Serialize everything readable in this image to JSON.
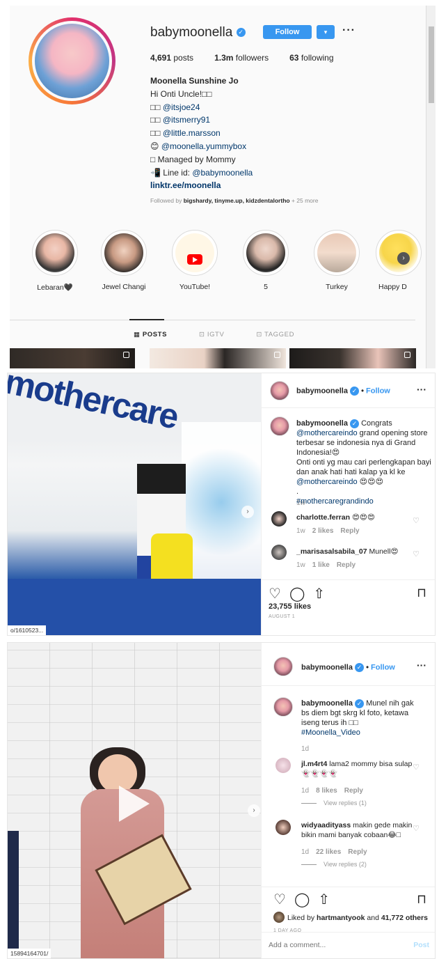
{
  "profile": {
    "username": "babymoonella",
    "follow_label": "Follow",
    "dropdown_label": "▾",
    "more_label": "···",
    "stats": {
      "posts": "4,691",
      "posts_label": "posts",
      "followers": "1.3m",
      "followers_label": "followers",
      "following": "63",
      "following_label": "following"
    },
    "bio": {
      "name": "Moonella Sunshine Jo",
      "line1": "Hi Onti Uncle!□□",
      "line2_prefix": "□□ ",
      "line2_link": "@itsjoe24",
      "line3_prefix": "□□ ",
      "line3_link": "@itsmerry91",
      "line4_prefix": "□□ ",
      "line4_link": "@little.marsson",
      "line5_prefix": "😊 ",
      "line5_link": "@moonella.yummybox",
      "line6": "□ Managed by Mommy",
      "line7_prefix": "📲 Line id: ",
      "line7_link": "@babymoonella",
      "website": "linktr.ee/moonella"
    },
    "followed_by": {
      "prefix": "Followed by ",
      "names": "bigshardy, tinyme.up, kidzdentalortho",
      "suffix": " + 25 more"
    },
    "highlights": [
      {
        "label": "Lebaran🖤"
      },
      {
        "label": "Jewel Changi"
      },
      {
        "label": "YouTube!"
      },
      {
        "label": "5"
      },
      {
        "label": "Turkey"
      },
      {
        "label": "Happy D"
      }
    ],
    "tabs": {
      "posts": "▦ POSTS",
      "igtv": "⊡ IGTV",
      "tagged": "⊡ TAGGED"
    }
  },
  "post1": {
    "header_user": "babymoonella",
    "header_follow": "Follow",
    "caption_user": "babymoonella",
    "caption_text": "Congrats",
    "caption_mention": "@mothercareindo",
    "caption_rest": " grand opening store terbesar se indonesia nya di Grand Indonesia!😍",
    "caption_line2": "Onti onti yg mau cari perlengkapan bayi dan anak hati hati kalap ya kl ke",
    "caption_mention2": "@mothercareindo",
    "caption_emoji": " 😍😍😍",
    "caption_dot": ".",
    "caption_hashtag": "#mothercaregrandindo",
    "caption_age": "1w",
    "comments": [
      {
        "user": "charlotte.ferran",
        "text": " 😍😍😍",
        "age": "1w",
        "likes": "2 likes",
        "reply": "Reply"
      },
      {
        "user": "_marisasalsabila_07",
        "text": " Munell😍",
        "age": "1w",
        "likes": "1 like",
        "reply": "Reply"
      }
    ],
    "likes": "23,755 likes",
    "date": "AUGUST 1",
    "photo_sign": "mothercare",
    "url_fragment": "o/1610523..."
  },
  "post2": {
    "header_user": "babymoonella",
    "header_follow": "Follow",
    "caption_user": "babymoonella",
    "caption_text": " Munel nih gak bs diem bgt skrg kl foto, ketawa iseng terus ih □□",
    "caption_hashtag": "#Moonella_Video",
    "caption_age": "1d",
    "comments": [
      {
        "user": "jl.m4rt4",
        "text": " lama2 mommy bisa sulap 👻👻👻👻",
        "age": "1d",
        "likes": "8 likes",
        "reply": "Reply",
        "view_replies": "View replies (1)"
      },
      {
        "user": "widyaadityass",
        "text": " makin gede makin bikin mami banyak cobaan😂□",
        "age": "1d",
        "likes": "22 likes",
        "reply": "Reply",
        "view_replies": "View replies (2)"
      }
    ],
    "liked_by_prefix": "Liked by ",
    "liked_by_user": "hartmantyook",
    "liked_by_suffix": " and ",
    "liked_by_count": "41,772 others",
    "date": "1 DAY AGO",
    "add_comment_placeholder": "Add a comment...",
    "post_label": "Post",
    "url_fragment": "15894164701/"
  },
  "colors": {
    "accent": "#3897f0",
    "link": "#00376b",
    "muted": "#8e8e8e",
    "border": "#dbdbdb"
  },
  "icons": [
    "verified-badge-icon",
    "heart-icon",
    "comment-icon",
    "share-icon",
    "bookmark-icon",
    "play-icon",
    "next-arrow-icon",
    "multi-post-icon"
  ]
}
